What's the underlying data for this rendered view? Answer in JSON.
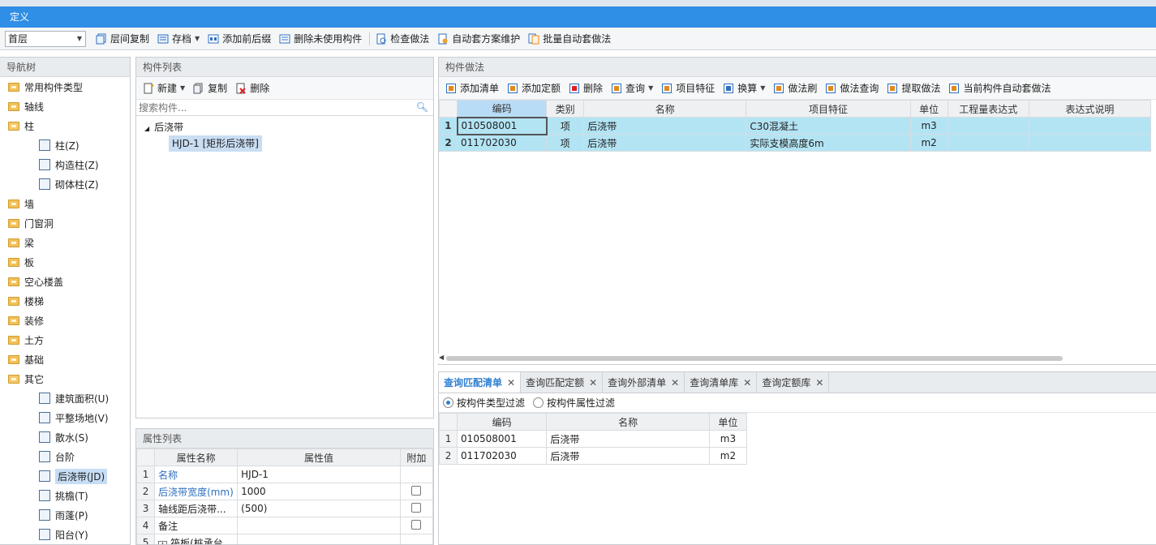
{
  "window": {
    "title": "定义"
  },
  "toolbar": {
    "floor": "首层",
    "items": [
      "层间复制",
      "存档",
      "添加前后缀",
      "删除未使用构件",
      "检查做法",
      "自动套方案维护",
      "批量自动套做法"
    ]
  },
  "nav": {
    "title": "导航树",
    "items": [
      {
        "label": "常用构件类型",
        "level": 0,
        "icon": "folder-icon"
      },
      {
        "label": "轴线",
        "level": 0,
        "icon": "folder-icon"
      },
      {
        "label": "柱",
        "level": 0,
        "icon": "folder-open-icon"
      },
      {
        "label": "柱(Z)",
        "level": 1,
        "icon": "column-icon"
      },
      {
        "label": "构造柱(Z)",
        "level": 1,
        "icon": "construct-column-icon"
      },
      {
        "label": "砌体柱(Z)",
        "level": 1,
        "icon": "masonry-column-icon"
      },
      {
        "label": "墙",
        "level": 0,
        "icon": "folder-icon"
      },
      {
        "label": "门窗洞",
        "level": 0,
        "icon": "folder-icon"
      },
      {
        "label": "梁",
        "level": 0,
        "icon": "folder-icon"
      },
      {
        "label": "板",
        "level": 0,
        "icon": "folder-icon"
      },
      {
        "label": "空心楼盖",
        "level": 0,
        "icon": "folder-icon"
      },
      {
        "label": "楼梯",
        "level": 0,
        "icon": "folder-icon"
      },
      {
        "label": "装修",
        "level": 0,
        "icon": "folder-icon"
      },
      {
        "label": "土方",
        "level": 0,
        "icon": "folder-icon"
      },
      {
        "label": "基础",
        "level": 0,
        "icon": "folder-icon"
      },
      {
        "label": "其它",
        "level": 0,
        "icon": "folder-open-icon"
      },
      {
        "label": "建筑面积(U)",
        "level": 1,
        "icon": "area-icon"
      },
      {
        "label": "平整场地(V)",
        "level": 1,
        "icon": "shovel-icon"
      },
      {
        "label": "散水(S)",
        "level": 1,
        "icon": "apron-icon"
      },
      {
        "label": "台阶",
        "level": 1,
        "icon": "steps-icon"
      },
      {
        "label": "后浇带(JD)",
        "level": 1,
        "icon": "post-pour-icon",
        "selected": true
      },
      {
        "label": "挑檐(T)",
        "level": 1,
        "icon": "eave-icon"
      },
      {
        "label": "雨蓬(P)",
        "level": 1,
        "icon": "canopy-icon"
      },
      {
        "label": "阳台(Y)",
        "level": 1,
        "icon": "balcony-icon"
      }
    ]
  },
  "component_list": {
    "title": "构件列表",
    "new": "新建",
    "copy": "复制",
    "delete": "删除",
    "search_placeholder": "搜索构件...",
    "group": "后浇带",
    "item": "HJD-1 [矩形后浇带]"
  },
  "property_list": {
    "title": "属性列表",
    "headers": [
      "属性名称",
      "属性值",
      "附加"
    ],
    "rows": [
      {
        "no": "1",
        "name": "名称",
        "value": "HJD-1",
        "blue": true,
        "check": false
      },
      {
        "no": "2",
        "name": "后浇带宽度(mm)",
        "value": "1000",
        "blue": true,
        "check": true
      },
      {
        "no": "3",
        "name": "轴线距后浇带...",
        "value": "(500)",
        "blue": false,
        "check": true
      },
      {
        "no": "4",
        "name": "备注",
        "value": "",
        "blue": false,
        "check": true
      },
      {
        "no": "5",
        "name": "筏板(桩承台...",
        "value": "",
        "blue": false,
        "check": false,
        "expand": "+"
      }
    ]
  },
  "method": {
    "title": "构件做法",
    "tools": [
      "添加清单",
      "添加定额",
      "删除",
      "查询",
      "项目特征",
      "换算",
      "做法刷",
      "做法查询",
      "提取做法",
      "当前构件自动套做法"
    ],
    "headers": [
      "编码",
      "类别",
      "名称",
      "项目特征",
      "单位",
      "工程量表达式",
      "表达式说明"
    ],
    "rows": [
      {
        "no": "1",
        "code": "010508001",
        "cat": "项",
        "name": "后浇带",
        "feature": "C30混凝土",
        "unit": "m3"
      },
      {
        "no": "2",
        "code": "011702030",
        "cat": "项",
        "name": "后浇带",
        "feature": "实际支模高度6m",
        "unit": "m2"
      }
    ]
  },
  "query": {
    "tabs": [
      "查询匹配清单",
      "查询匹配定额",
      "查询外部清单",
      "查询清单库",
      "查询定额库"
    ],
    "filter_type": "按构件类型过滤",
    "filter_attr": "按构件属性过滤",
    "headers": [
      "编码",
      "名称",
      "单位"
    ],
    "rows": [
      {
        "no": "1",
        "code": "010508001",
        "name": "后浇带",
        "unit": "m3"
      },
      {
        "no": "2",
        "code": "011702030",
        "name": "后浇带",
        "unit": "m2"
      }
    ]
  }
}
